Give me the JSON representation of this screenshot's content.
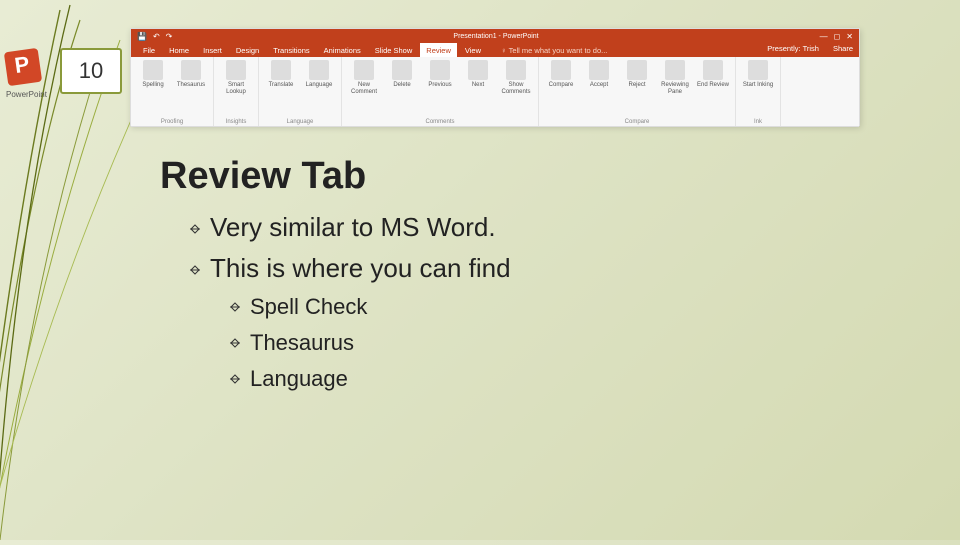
{
  "slide": {
    "number": "10",
    "logo_label": "PowerPoint"
  },
  "ribbon": {
    "title_center": "Presentation1 - PowerPoint",
    "title_right": {
      "signin": "Presently: Trish",
      "share": "Share"
    },
    "tabs": [
      "File",
      "Home",
      "Insert",
      "Design",
      "Transitions",
      "Animations",
      "Slide Show",
      "Review",
      "View"
    ],
    "active_tab": "Review",
    "tell_me": "Tell me what you want to do...",
    "groups": [
      {
        "label": "Proofing",
        "items": [
          {
            "name": "spelling",
            "label": "Spelling"
          },
          {
            "name": "thesaurus",
            "label": "Thesaurus"
          }
        ]
      },
      {
        "label": "Insights",
        "items": [
          {
            "name": "smart-lookup",
            "label": "Smart Lookup"
          }
        ]
      },
      {
        "label": "Language",
        "items": [
          {
            "name": "translate",
            "label": "Translate"
          },
          {
            "name": "language",
            "label": "Language"
          }
        ]
      },
      {
        "label": "Comments",
        "items": [
          {
            "name": "new-comment",
            "label": "New Comment"
          },
          {
            "name": "delete",
            "label": "Delete"
          },
          {
            "name": "previous",
            "label": "Previous"
          },
          {
            "name": "next",
            "label": "Next"
          },
          {
            "name": "show-comments",
            "label": "Show Comments"
          }
        ]
      },
      {
        "label": "Compare",
        "items": [
          {
            "name": "compare",
            "label": "Compare"
          },
          {
            "name": "accept",
            "label": "Accept"
          },
          {
            "name": "reject",
            "label": "Reject"
          },
          {
            "name": "reviewing-pane",
            "label": "Reviewing Pane"
          },
          {
            "name": "end-review",
            "label": "End Review"
          }
        ]
      },
      {
        "label": "Ink",
        "items": [
          {
            "name": "start-inking",
            "label": "Start Inking"
          }
        ]
      }
    ]
  },
  "content": {
    "heading": "Review Tab",
    "bullets_l1": [
      "Very similar to MS Word.",
      "This is where you can find"
    ],
    "bullets_l2": [
      "Spell Check",
      "Thesaurus",
      "Language"
    ]
  }
}
